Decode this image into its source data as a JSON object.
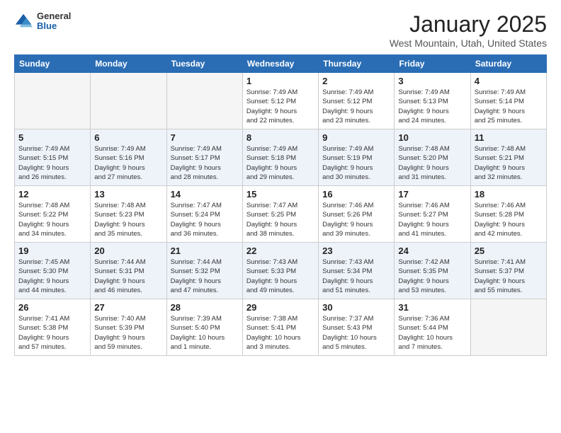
{
  "header": {
    "logo_general": "General",
    "logo_blue": "Blue",
    "title": "January 2025",
    "subtitle": "West Mountain, Utah, United States"
  },
  "days_of_week": [
    "Sunday",
    "Monday",
    "Tuesday",
    "Wednesday",
    "Thursday",
    "Friday",
    "Saturday"
  ],
  "weeks": [
    {
      "alt": false,
      "days": [
        {
          "num": "",
          "info": "",
          "empty": true
        },
        {
          "num": "",
          "info": "",
          "empty": true
        },
        {
          "num": "",
          "info": "",
          "empty": true
        },
        {
          "num": "1",
          "info": "Sunrise: 7:49 AM\nSunset: 5:12 PM\nDaylight: 9 hours\nand 22 minutes.",
          "empty": false
        },
        {
          "num": "2",
          "info": "Sunrise: 7:49 AM\nSunset: 5:12 PM\nDaylight: 9 hours\nand 23 minutes.",
          "empty": false
        },
        {
          "num": "3",
          "info": "Sunrise: 7:49 AM\nSunset: 5:13 PM\nDaylight: 9 hours\nand 24 minutes.",
          "empty": false
        },
        {
          "num": "4",
          "info": "Sunrise: 7:49 AM\nSunset: 5:14 PM\nDaylight: 9 hours\nand 25 minutes.",
          "empty": false
        }
      ]
    },
    {
      "alt": true,
      "days": [
        {
          "num": "5",
          "info": "Sunrise: 7:49 AM\nSunset: 5:15 PM\nDaylight: 9 hours\nand 26 minutes.",
          "empty": false
        },
        {
          "num": "6",
          "info": "Sunrise: 7:49 AM\nSunset: 5:16 PM\nDaylight: 9 hours\nand 27 minutes.",
          "empty": false
        },
        {
          "num": "7",
          "info": "Sunrise: 7:49 AM\nSunset: 5:17 PM\nDaylight: 9 hours\nand 28 minutes.",
          "empty": false
        },
        {
          "num": "8",
          "info": "Sunrise: 7:49 AM\nSunset: 5:18 PM\nDaylight: 9 hours\nand 29 minutes.",
          "empty": false
        },
        {
          "num": "9",
          "info": "Sunrise: 7:49 AM\nSunset: 5:19 PM\nDaylight: 9 hours\nand 30 minutes.",
          "empty": false
        },
        {
          "num": "10",
          "info": "Sunrise: 7:48 AM\nSunset: 5:20 PM\nDaylight: 9 hours\nand 31 minutes.",
          "empty": false
        },
        {
          "num": "11",
          "info": "Sunrise: 7:48 AM\nSunset: 5:21 PM\nDaylight: 9 hours\nand 32 minutes.",
          "empty": false
        }
      ]
    },
    {
      "alt": false,
      "days": [
        {
          "num": "12",
          "info": "Sunrise: 7:48 AM\nSunset: 5:22 PM\nDaylight: 9 hours\nand 34 minutes.",
          "empty": false
        },
        {
          "num": "13",
          "info": "Sunrise: 7:48 AM\nSunset: 5:23 PM\nDaylight: 9 hours\nand 35 minutes.",
          "empty": false
        },
        {
          "num": "14",
          "info": "Sunrise: 7:47 AM\nSunset: 5:24 PM\nDaylight: 9 hours\nand 36 minutes.",
          "empty": false
        },
        {
          "num": "15",
          "info": "Sunrise: 7:47 AM\nSunset: 5:25 PM\nDaylight: 9 hours\nand 38 minutes.",
          "empty": false
        },
        {
          "num": "16",
          "info": "Sunrise: 7:46 AM\nSunset: 5:26 PM\nDaylight: 9 hours\nand 39 minutes.",
          "empty": false
        },
        {
          "num": "17",
          "info": "Sunrise: 7:46 AM\nSunset: 5:27 PM\nDaylight: 9 hours\nand 41 minutes.",
          "empty": false
        },
        {
          "num": "18",
          "info": "Sunrise: 7:46 AM\nSunset: 5:28 PM\nDaylight: 9 hours\nand 42 minutes.",
          "empty": false
        }
      ]
    },
    {
      "alt": true,
      "days": [
        {
          "num": "19",
          "info": "Sunrise: 7:45 AM\nSunset: 5:30 PM\nDaylight: 9 hours\nand 44 minutes.",
          "empty": false
        },
        {
          "num": "20",
          "info": "Sunrise: 7:44 AM\nSunset: 5:31 PM\nDaylight: 9 hours\nand 46 minutes.",
          "empty": false
        },
        {
          "num": "21",
          "info": "Sunrise: 7:44 AM\nSunset: 5:32 PM\nDaylight: 9 hours\nand 47 minutes.",
          "empty": false
        },
        {
          "num": "22",
          "info": "Sunrise: 7:43 AM\nSunset: 5:33 PM\nDaylight: 9 hours\nand 49 minutes.",
          "empty": false
        },
        {
          "num": "23",
          "info": "Sunrise: 7:43 AM\nSunset: 5:34 PM\nDaylight: 9 hours\nand 51 minutes.",
          "empty": false
        },
        {
          "num": "24",
          "info": "Sunrise: 7:42 AM\nSunset: 5:35 PM\nDaylight: 9 hours\nand 53 minutes.",
          "empty": false
        },
        {
          "num": "25",
          "info": "Sunrise: 7:41 AM\nSunset: 5:37 PM\nDaylight: 9 hours\nand 55 minutes.",
          "empty": false
        }
      ]
    },
    {
      "alt": false,
      "days": [
        {
          "num": "26",
          "info": "Sunrise: 7:41 AM\nSunset: 5:38 PM\nDaylight: 9 hours\nand 57 minutes.",
          "empty": false
        },
        {
          "num": "27",
          "info": "Sunrise: 7:40 AM\nSunset: 5:39 PM\nDaylight: 9 hours\nand 59 minutes.",
          "empty": false
        },
        {
          "num": "28",
          "info": "Sunrise: 7:39 AM\nSunset: 5:40 PM\nDaylight: 10 hours\nand 1 minute.",
          "empty": false
        },
        {
          "num": "29",
          "info": "Sunrise: 7:38 AM\nSunset: 5:41 PM\nDaylight: 10 hours\nand 3 minutes.",
          "empty": false
        },
        {
          "num": "30",
          "info": "Sunrise: 7:37 AM\nSunset: 5:43 PM\nDaylight: 10 hours\nand 5 minutes.",
          "empty": false
        },
        {
          "num": "31",
          "info": "Sunrise: 7:36 AM\nSunset: 5:44 PM\nDaylight: 10 hours\nand 7 minutes.",
          "empty": false
        },
        {
          "num": "",
          "info": "",
          "empty": true
        }
      ]
    }
  ]
}
